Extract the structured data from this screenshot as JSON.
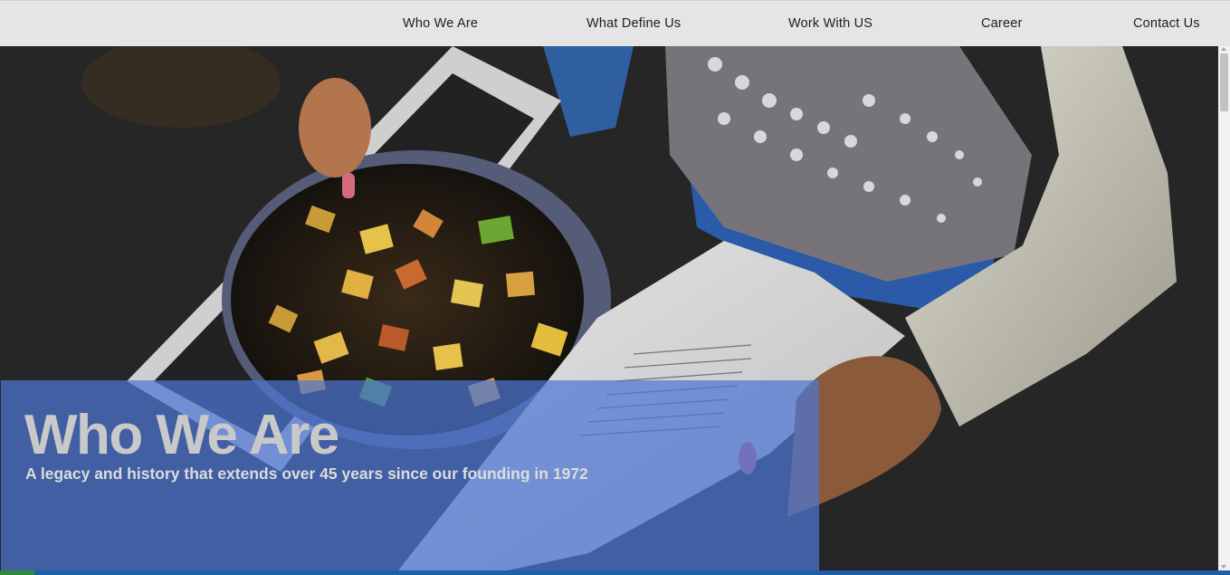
{
  "nav": {
    "items": [
      {
        "label": "Who We Are"
      },
      {
        "label": "What Define Us"
      },
      {
        "label": "Work With US"
      },
      {
        "label": "Career"
      },
      {
        "label": "Contact Us"
      }
    ]
  },
  "hero": {
    "title": "Who We Are",
    "subtitle": "A legacy and history that extends over 45 years since our founding in 1972",
    "overlay_color": "#4c76d2"
  },
  "colors": {
    "navbar_bg": "#e5e5e5",
    "nav_text": "#1e1e1e",
    "hero_dark": "#262626",
    "bottom_strip": "#1f5fa8"
  }
}
